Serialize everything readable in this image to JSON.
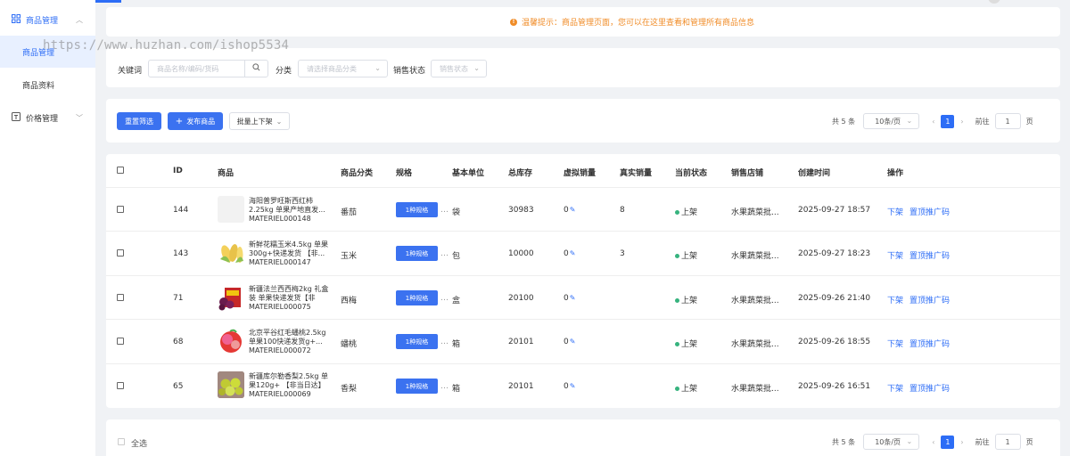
{
  "sidebar": {
    "group1": {
      "label": "商品管理"
    },
    "items": [
      {
        "label": "商品管理",
        "active": true
      },
      {
        "label": "商品资料",
        "active": false
      }
    ],
    "group2": {
      "label": "价格管理"
    }
  },
  "watermark": "https://www.huzhan.com/ishop5534",
  "tip": "温馨提示：商品管理页面，您可以在这里查看和管理所有商品信息",
  "filters": {
    "keyword_label": "关键词",
    "keyword_placeholder": "商品名称/编码/货码",
    "category_label": "分类",
    "category_placeholder": "请选择商品分类",
    "status_label": "销售状态",
    "status_placeholder": "销售状态"
  },
  "toolbar": {
    "reset": "重置筛选",
    "publish": "发布商品",
    "batch": "批量上下架"
  },
  "pager": {
    "total": "共 5 条",
    "page_size": "10条/页",
    "page": "1",
    "goto_prefix": "前往",
    "goto_value": "1",
    "goto_suffix": "页"
  },
  "table": {
    "headers": [
      "ID",
      "商品",
      "商品分类",
      "规格",
      "基本单位",
      "总库存",
      "虚拟销量",
      "真实销量",
      "当前状态",
      "销售店铺",
      "创建时间",
      "操作"
    ],
    "rows": [
      {
        "id": "144",
        "name": "海阳普罗旺斯西红柿2.25kg 单果产地直发...",
        "code": "MATERIEL000148",
        "category": "番茄",
        "spec": "1种规格",
        "unit": "袋",
        "stock": "30983",
        "virtual": "0",
        "real": "8",
        "status": "上架",
        "shop": "水果蔬菜批...",
        "created": "2025-09-27 18:57",
        "op1": "下架",
        "op2": "置顶推广码"
      },
      {
        "id": "143",
        "name": "新鲜花糯玉米4.5kg 单果300g+快递发货 【非...",
        "code": "MATERIEL000147",
        "category": "玉米",
        "spec": "1种规格",
        "unit": "包",
        "stock": "10000",
        "virtual": "0",
        "real": "3",
        "status": "上架",
        "shop": "水果蔬菜批...",
        "created": "2025-09-27 18:23",
        "op1": "下架",
        "op2": "置顶推广码"
      },
      {
        "id": "71",
        "name": "新疆法兰西西梅2kg 礼盒装 单果快递发货【非当...",
        "code": "MATERIEL000075",
        "category": "西梅",
        "spec": "1种规格",
        "unit": "盒",
        "stock": "20100",
        "virtual": "0",
        "real": "",
        "status": "上架",
        "shop": "水果蔬菜批...",
        "created": "2025-09-26 21:40",
        "op1": "下架",
        "op2": "置顶推广码"
      },
      {
        "id": "68",
        "name": "北京平谷红毛蟠桃2.5kg 单果100快递发货g+...",
        "code": "MATERIEL000072",
        "category": "蟠桃",
        "spec": "1种规格",
        "unit": "箱",
        "stock": "20101",
        "virtual": "0",
        "real": "",
        "status": "上架",
        "shop": "水果蔬菜批...",
        "created": "2025-09-26 18:55",
        "op1": "下架",
        "op2": "置顶推广码"
      },
      {
        "id": "65",
        "name": "新疆库尔勒香梨2.5kg 单果120g+ 【非当日达】",
        "code": "MATERIEL000069",
        "category": "香梨",
        "spec": "1种规格",
        "unit": "箱",
        "stock": "20101",
        "virtual": "0",
        "real": "",
        "status": "上架",
        "shop": "水果蔬菜批...",
        "created": "2025-09-26 16:51",
        "op1": "下架",
        "op2": "置顶推广码"
      }
    ]
  },
  "footer": {
    "select_all": "全选"
  },
  "colors": {
    "primary": "#2d6df6",
    "warning": "#f08c28",
    "success": "#36b37e"
  },
  "icons": {
    "nav_group1": "grid-icon",
    "nav_group2": "price-tag-icon",
    "search": "search-icon",
    "pencil": "edit-pencil-icon"
  }
}
